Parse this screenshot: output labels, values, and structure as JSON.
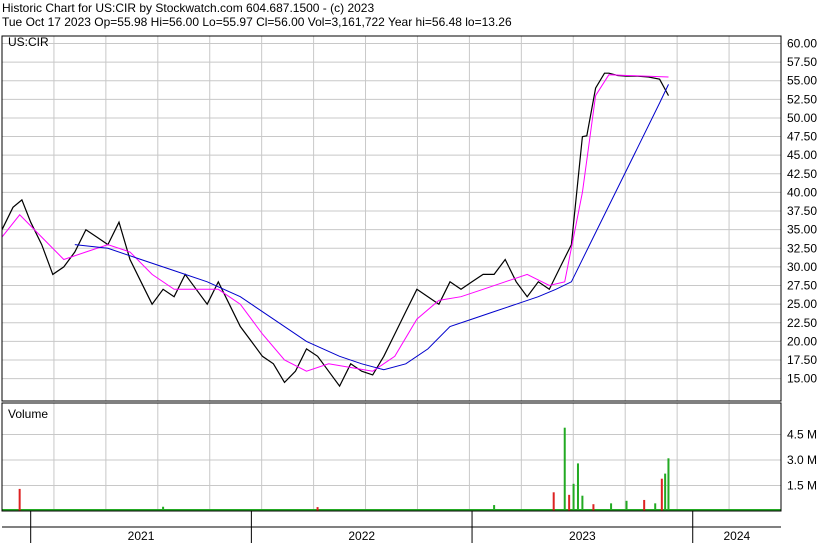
{
  "header": {
    "line1": "Historic Chart for US:CIR by Stockwatch.com 604.687.1500 - (c) 2023",
    "line2": "Tue Oct 17 2023   Op=55.98   Hi=56.00   Lo=55.97   Cl=56.00   Vol=3,161,722   Year hi=56.48   lo=13.26"
  },
  "colors": {
    "price": "#000000",
    "ma_short": "#ff00ff",
    "ma_long": "#0000cc",
    "vol_up": "#22aa22",
    "vol_down": "#dd2222",
    "grid": "#c8c8c8",
    "frame": "#000000"
  },
  "chart_data": [
    {
      "type": "line",
      "panel": "price",
      "label": "US:CIR",
      "ylim": [
        12,
        61
      ],
      "yticks": [
        "15.00",
        "17.50",
        "20.00",
        "22.50",
        "25.00",
        "27.50",
        "30.00",
        "32.50",
        "35.00",
        "37.50",
        "40.00",
        "42.50",
        "45.00",
        "47.50",
        "50.00",
        "52.50",
        "55.00",
        "57.50",
        "60.00"
      ],
      "x_range": [
        2020.87,
        2024.4
      ],
      "x_axis_labels": [
        "2021",
        "2022",
        "2023",
        "2024"
      ],
      "series": [
        {
          "kind": "price",
          "x": [
            2020.87,
            2020.92,
            2020.96,
            2021.0,
            2021.05,
            2021.1,
            2021.15,
            2021.2,
            2021.25,
            2021.3,
            2021.35,
            2021.4,
            2021.45,
            2021.5,
            2021.55,
            2021.6,
            2021.65,
            2021.7,
            2021.75,
            2021.8,
            2021.85,
            2021.9,
            2021.95,
            2022.0,
            2022.05,
            2022.1,
            2022.15,
            2022.2,
            2022.25,
            2022.3,
            2022.35,
            2022.4,
            2022.45,
            2022.5,
            2022.55,
            2022.6,
            2022.65,
            2022.7,
            2022.75,
            2022.8,
            2022.85,
            2022.9,
            2022.95,
            2023.0,
            2023.05,
            2023.1,
            2023.15,
            2023.2,
            2023.25,
            2023.3,
            2023.35,
            2023.4,
            2023.45,
            2023.5,
            2023.52,
            2023.56,
            2023.6,
            2023.62,
            2023.66,
            2023.7,
            2023.75,
            2023.8,
            2023.85,
            2023.89
          ],
          "y": [
            35,
            38,
            39,
            36,
            33,
            29,
            30,
            32,
            35,
            34,
            33,
            36,
            31,
            28,
            25,
            27,
            26,
            29,
            27,
            25,
            28,
            25,
            22,
            20,
            18,
            17,
            14.5,
            16,
            19,
            18,
            16,
            14,
            17,
            16,
            15.5,
            18,
            21,
            24,
            27,
            26,
            25,
            28,
            27,
            28,
            29,
            29,
            31,
            28,
            26,
            28,
            27,
            30,
            33,
            47.5,
            47.6,
            54,
            56,
            56,
            55.7,
            55.6,
            55.6,
            55.5,
            55.2,
            53
          ]
        },
        {
          "kind": "ma_short",
          "x": [
            2020.87,
            2020.95,
            2021.05,
            2021.15,
            2021.25,
            2021.35,
            2021.45,
            2021.55,
            2021.65,
            2021.75,
            2021.85,
            2021.95,
            2022.05,
            2022.15,
            2022.25,
            2022.35,
            2022.45,
            2022.55,
            2022.65,
            2022.75,
            2022.85,
            2022.95,
            2023.05,
            2023.15,
            2023.25,
            2023.35,
            2023.42,
            2023.5,
            2023.56,
            2023.62,
            2023.7,
            2023.8,
            2023.89
          ],
          "y": [
            34,
            37,
            34,
            31,
            32,
            33,
            32,
            29,
            27,
            27,
            27,
            25,
            21,
            17.5,
            16,
            17,
            16.5,
            16,
            18,
            23,
            25.5,
            26,
            27,
            28,
            29,
            27.5,
            28,
            40,
            53,
            55.8,
            55.7,
            55.6,
            55.5
          ]
        },
        {
          "kind": "ma_long",
          "x": [
            2021.2,
            2021.35,
            2021.5,
            2021.65,
            2021.8,
            2021.95,
            2022.1,
            2022.25,
            2022.4,
            2022.5,
            2022.6,
            2022.7,
            2022.8,
            2022.9,
            2023.0,
            2023.1,
            2023.2,
            2023.3,
            2023.38,
            2023.45,
            2023.55,
            2023.65,
            2023.75,
            2023.85,
            2023.89
          ],
          "y": [
            33,
            32.5,
            31,
            29.5,
            28,
            26,
            23,
            20,
            18,
            17,
            16.2,
            17,
            19,
            22,
            23,
            24,
            25,
            26,
            27,
            28,
            34,
            40,
            46,
            52,
            54.5
          ]
        }
      ]
    },
    {
      "type": "bar",
      "panel": "volume",
      "label": "Volume",
      "ylim": [
        0,
        6000000
      ],
      "yticks": [
        "1.5 M",
        "3.0 M",
        "4.5 M"
      ],
      "x_range": [
        2020.87,
        2024.4
      ],
      "bars": [
        {
          "x": 2020.95,
          "v": 1300000,
          "dir": "down"
        },
        {
          "x": 2021.6,
          "v": 250000,
          "dir": "up"
        },
        {
          "x": 2022.3,
          "v": 230000,
          "dir": "down"
        },
        {
          "x": 2023.1,
          "v": 350000,
          "dir": "up"
        },
        {
          "x": 2023.37,
          "v": 1100000,
          "dir": "down"
        },
        {
          "x": 2023.42,
          "v": 4900000,
          "dir": "up"
        },
        {
          "x": 2023.44,
          "v": 950000,
          "dir": "down"
        },
        {
          "x": 2023.46,
          "v": 1600000,
          "dir": "up"
        },
        {
          "x": 2023.48,
          "v": 2800000,
          "dir": "up"
        },
        {
          "x": 2023.5,
          "v": 900000,
          "dir": "up"
        },
        {
          "x": 2023.55,
          "v": 400000,
          "dir": "down"
        },
        {
          "x": 2023.63,
          "v": 450000,
          "dir": "up"
        },
        {
          "x": 2023.7,
          "v": 600000,
          "dir": "up"
        },
        {
          "x": 2023.78,
          "v": 650000,
          "dir": "down"
        },
        {
          "x": 2023.83,
          "v": 450000,
          "dir": "up"
        },
        {
          "x": 2023.86,
          "v": 1900000,
          "dir": "down"
        },
        {
          "x": 2023.875,
          "v": 2200000,
          "dir": "up"
        },
        {
          "x": 2023.89,
          "v": 3100000,
          "dir": "up"
        }
      ]
    }
  ]
}
